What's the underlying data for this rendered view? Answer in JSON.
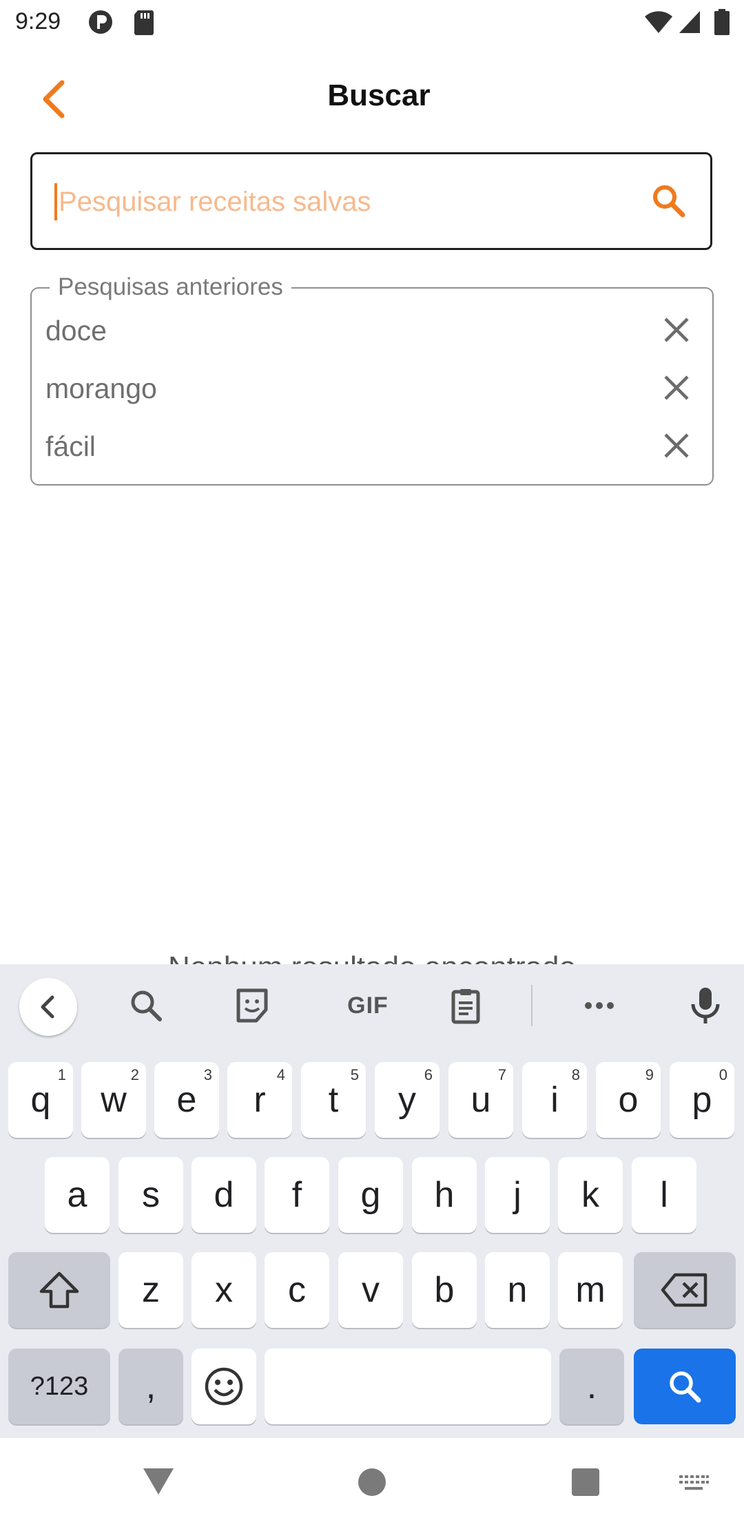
{
  "status_bar": {
    "time": "9:29"
  },
  "header": {
    "title": "Buscar"
  },
  "search": {
    "placeholder": "Pesquisar receitas salvas",
    "value": ""
  },
  "history": {
    "legend": "Pesquisas anteriores",
    "items": [
      {
        "label": "doce"
      },
      {
        "label": "morango"
      },
      {
        "label": "fácil"
      }
    ]
  },
  "empty_state": {
    "text": "Nenhum resultado encontrado"
  },
  "keyboard": {
    "row1": [
      {
        "k": "q",
        "h": "1"
      },
      {
        "k": "w",
        "h": "2"
      },
      {
        "k": "e",
        "h": "3"
      },
      {
        "k": "r",
        "h": "4"
      },
      {
        "k": "t",
        "h": "5"
      },
      {
        "k": "y",
        "h": "6"
      },
      {
        "k": "u",
        "h": "7"
      },
      {
        "k": "i",
        "h": "8"
      },
      {
        "k": "o",
        "h": "9"
      },
      {
        "k": "p",
        "h": "0"
      }
    ],
    "row2": [
      "a",
      "s",
      "d",
      "f",
      "g",
      "h",
      "j",
      "k",
      "l"
    ],
    "row3": [
      "z",
      "x",
      "c",
      "v",
      "b",
      "n",
      "m"
    ],
    "symbols_label": "?123",
    "comma": ",",
    "period": ".",
    "gif_label": "GIF"
  },
  "colors": {
    "accent": "#F07A1E",
    "placeholder": "#F7B98D",
    "keyboard_bg": "#E9EBF1",
    "go_key": "#1A73E8"
  }
}
